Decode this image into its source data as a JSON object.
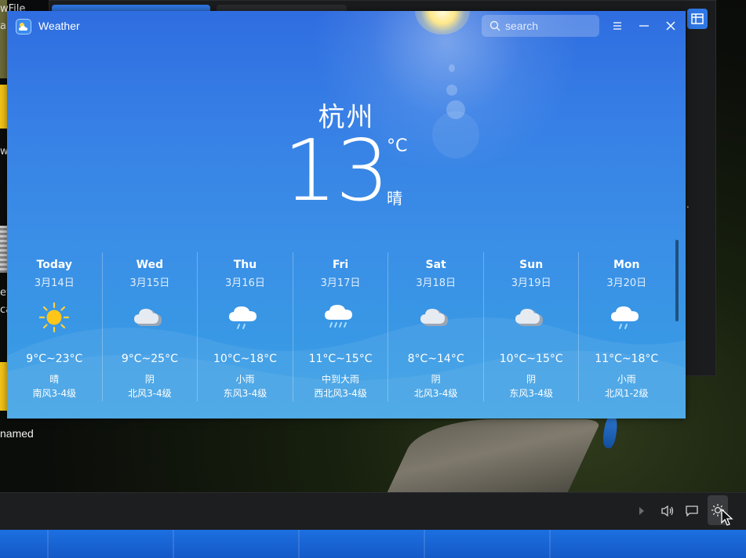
{
  "desktop": {
    "unnamed_label": "named",
    "left_labels": [
      "wFile",
      "a",
      "w",
      "ew",
      "ca"
    ],
    "background_ellipsis": "…"
  },
  "app": {
    "title": "Weather",
    "search": {
      "placeholder": "search",
      "value": ""
    },
    "menu_icon": "menu-icon",
    "minimize_icon": "minimize-icon",
    "close_icon": "close-icon"
  },
  "current": {
    "city": "杭州",
    "temperature": "13",
    "unit": "°C",
    "condition": "晴"
  },
  "forecast": [
    {
      "day": "Today",
      "date": "3月14日",
      "icon": "sunny-icon",
      "range": "9°C~23°C",
      "condition": "晴",
      "wind": "南风3-4级"
    },
    {
      "day": "Wed",
      "date": "3月15日",
      "icon": "cloudy-icon",
      "range": "9°C~25°C",
      "condition": "阴",
      "wind": "北风3-4级"
    },
    {
      "day": "Thu",
      "date": "3月16日",
      "icon": "light-rain-icon",
      "range": "10°C~18°C",
      "condition": "小雨",
      "wind": "东风3-4级"
    },
    {
      "day": "Fri",
      "date": "3月17日",
      "icon": "heavy-rain-icon",
      "range": "11°C~15°C",
      "condition": "中到大雨",
      "wind": "西北风3-4级"
    },
    {
      "day": "Sat",
      "date": "3月18日",
      "icon": "cloudy-icon",
      "range": "8°C~14°C",
      "condition": "阴",
      "wind": "北风3-4级"
    },
    {
      "day": "Sun",
      "date": "3月19日",
      "icon": "cloudy-icon",
      "range": "10°C~15°C",
      "condition": "阴",
      "wind": "东风3-4级"
    },
    {
      "day": "Mon",
      "date": "3月20日",
      "icon": "light-rain-icon",
      "range": "11°C~18°C",
      "condition": "小雨",
      "wind": "北风1-2级"
    }
  ],
  "taskbar": {
    "icons": [
      "arrow-right-icon",
      "volume-icon",
      "notification-icon",
      "brightness-icon"
    ]
  },
  "colors": {
    "accent": "#2f77e4",
    "weather_top": "#2f6de0",
    "weather_bottom": "#38a0e4"
  }
}
